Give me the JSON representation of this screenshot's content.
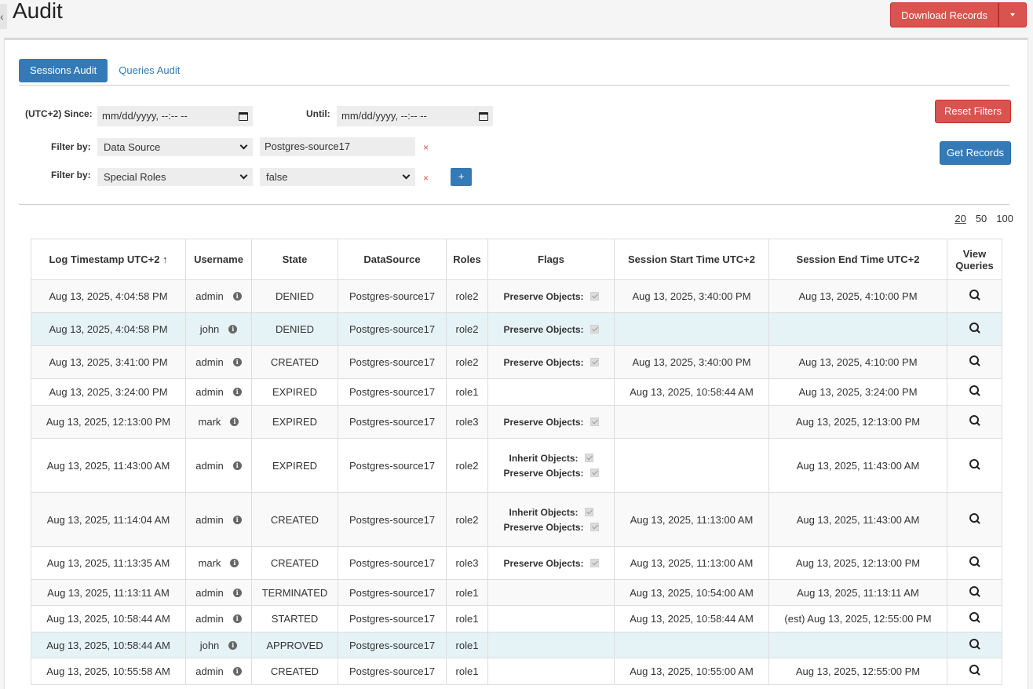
{
  "header": {
    "title": "Audit",
    "back_glyph": "‹",
    "download_label": "Download Records"
  },
  "tabs": [
    {
      "label": "Sessions Audit",
      "active": true
    },
    {
      "label": "Queries Audit",
      "active": false
    }
  ],
  "filters": {
    "since_label": "(UTC+2) Since:",
    "since_placeholder": "mm/dd/yyyy, --:-- --",
    "until_label": "Until:",
    "until_placeholder": "mm/dd/yyyy, --:-- --",
    "filter_by_label": "Filter by:",
    "filter1_field": "Data Source",
    "filter1_value": "Postgres-source17",
    "filter2_field": "Special Roles",
    "filter2_value": "false",
    "remove_glyph": "×",
    "add_glyph": "+",
    "reset_label": "Reset Filters",
    "get_label": "Get Records"
  },
  "page_sizes": [
    "20",
    "50",
    "100"
  ],
  "table": {
    "headers": [
      "Log Timestamp UTC+2 ↑",
      "Username",
      "State",
      "DataSource",
      "Roles",
      "Flags",
      "Session Start Time UTC+2",
      "Session End Time UTC+2",
      "View Queries"
    ],
    "rows": [
      {
        "ts": "Aug 13, 2025, 4:04:58 PM",
        "user": "admin",
        "state": "DENIED",
        "ds": "Postgres-source17",
        "role": "role2",
        "flags": [
          "Preserve Objects:"
        ],
        "start": "Aug 13, 2025, 3:40:00 PM",
        "end": "Aug 13, 2025, 4:10:00 PM",
        "highlight": false
      },
      {
        "ts": "Aug 13, 2025, 4:04:58 PM",
        "user": "john",
        "state": "DENIED",
        "ds": "Postgres-source17",
        "role": "role2",
        "flags": [
          "Preserve Objects:"
        ],
        "start": "",
        "end": "",
        "highlight": true
      },
      {
        "ts": "Aug 13, 2025, 3:41:00 PM",
        "user": "admin",
        "state": "CREATED",
        "ds": "Postgres-source17",
        "role": "role2",
        "flags": [
          "Preserve Objects:"
        ],
        "start": "Aug 13, 2025, 3:40:00 PM",
        "end": "Aug 13, 2025, 4:10:00 PM",
        "highlight": false
      },
      {
        "ts": "Aug 13, 2025, 3:24:00 PM",
        "user": "admin",
        "state": "EXPIRED",
        "ds": "Postgres-source17",
        "role": "role1",
        "flags": [],
        "start": "Aug 13, 2025, 10:58:44 AM",
        "end": "Aug 13, 2025, 3:24:00 PM",
        "highlight": false
      },
      {
        "ts": "Aug 13, 2025, 12:13:00 PM",
        "user": "mark",
        "state": "EXPIRED",
        "ds": "Postgres-source17",
        "role": "role3",
        "flags": [
          "Preserve Objects:"
        ],
        "start": "",
        "end": "Aug 13, 2025, 12:13:00 PM",
        "highlight": false
      },
      {
        "ts": "Aug 13, 2025, 11:43:00 AM",
        "user": "admin",
        "state": "EXPIRED",
        "ds": "Postgres-source17",
        "role": "role2",
        "flags": [
          "Inherit Objects:",
          "Preserve Objects:"
        ],
        "start": "",
        "end": "Aug 13, 2025, 11:43:00 AM",
        "highlight": false
      },
      {
        "ts": "Aug 13, 2025, 11:14:04 AM",
        "user": "admin",
        "state": "CREATED",
        "ds": "Postgres-source17",
        "role": "role2",
        "flags": [
          "Inherit Objects:",
          "Preserve Objects:"
        ],
        "start": "Aug 13, 2025, 11:13:00 AM",
        "end": "Aug 13, 2025, 11:43:00 AM",
        "highlight": false
      },
      {
        "ts": "Aug 13, 2025, 11:13:35 AM",
        "user": "mark",
        "state": "CREATED",
        "ds": "Postgres-source17",
        "role": "role3",
        "flags": [
          "Preserve Objects:"
        ],
        "start": "Aug 13, 2025, 11:13:00 AM",
        "end": "Aug 13, 2025, 12:13:00 PM",
        "highlight": false
      },
      {
        "ts": "Aug 13, 2025, 11:13:11 AM",
        "user": "admin",
        "state": "TERMINATED",
        "ds": "Postgres-source17",
        "role": "role1",
        "flags": [],
        "start": "Aug 13, 2025, 10:54:00 AM",
        "end": "Aug 13, 2025, 11:13:11 AM",
        "highlight": false
      },
      {
        "ts": "Aug 13, 2025, 10:58:44 AM",
        "user": "admin",
        "state": "STARTED",
        "ds": "Postgres-source17",
        "role": "role1",
        "flags": [],
        "start": "Aug 13, 2025, 10:58:44 AM",
        "end": "(est) Aug 13, 2025, 12:55:00 PM",
        "highlight": false
      },
      {
        "ts": "Aug 13, 2025, 10:58:44 AM",
        "user": "john",
        "state": "APPROVED",
        "ds": "Postgres-source17",
        "role": "role1",
        "flags": [],
        "start": "",
        "end": "",
        "highlight": true
      },
      {
        "ts": "Aug 13, 2025, 10:55:58 AM",
        "user": "admin",
        "state": "CREATED",
        "ds": "Postgres-source17",
        "role": "role1",
        "flags": [],
        "start": "Aug 13, 2025, 10:55:00 AM",
        "end": "Aug 13, 2025, 12:55:00 PM",
        "highlight": false
      }
    ]
  }
}
